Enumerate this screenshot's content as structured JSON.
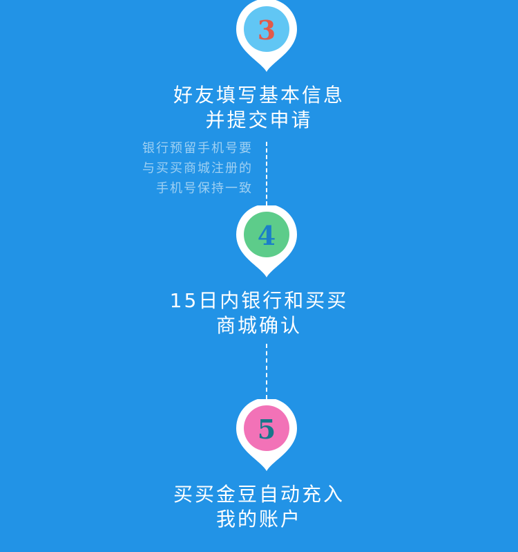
{
  "steps": [
    {
      "number": "3",
      "title_line1": "好友填写基本信息",
      "title_line2": "并提交申请",
      "circle_color": "#61c6f4",
      "number_color": "#e25a49"
    },
    {
      "number": "4",
      "title_line1": "15日内银行和买买",
      "title_line2": "商城确认",
      "circle_color": "#5dcc8a",
      "number_color": "#1b7fc8"
    },
    {
      "number": "5",
      "title_line1": "买买金豆自动充入",
      "title_line2": "我的账户",
      "circle_color": "#f272b7",
      "number_color": "#17768a"
    }
  ],
  "note": {
    "line1": "银行预留手机号要",
    "line2": "与买买商城注册的",
    "line3": "手机号保持一致"
  },
  "colors": {
    "background": "#2293e6",
    "pin_white": "#ffffff",
    "note_text": "#9fd0f2"
  }
}
